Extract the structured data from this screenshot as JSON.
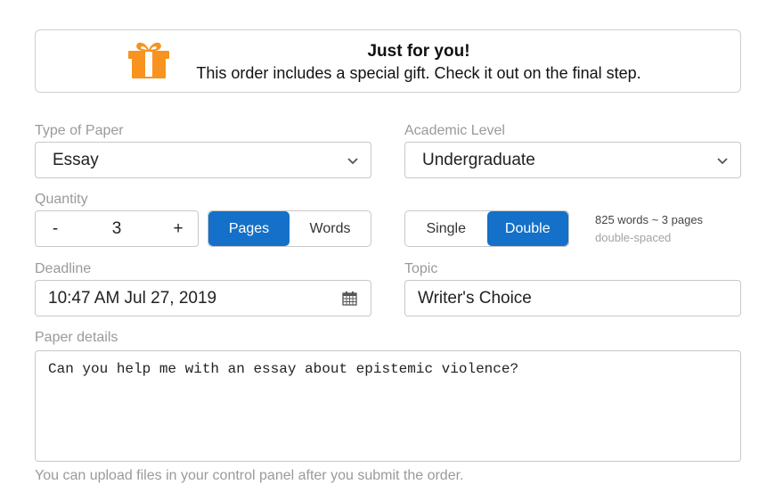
{
  "banner": {
    "icon": "gift-icon",
    "icon_color": "#f7931e",
    "title": "Just for you!",
    "subtitle": "This order includes a special gift. Check it out on the final step."
  },
  "form": {
    "type_of_paper": {
      "label": "Type of Paper",
      "value": "Essay"
    },
    "academic_level": {
      "label": "Academic Level",
      "value": "Undergraduate"
    },
    "quantity": {
      "label": "Quantity",
      "decrement": "-",
      "value": "3",
      "increment": "+",
      "units": [
        {
          "label": "Pages",
          "active": true
        },
        {
          "label": "Words",
          "active": false
        }
      ]
    },
    "spacing": {
      "options": [
        {
          "label": "Single",
          "active": false
        },
        {
          "label": "Double",
          "active": true
        }
      ],
      "summary": "825 words ~ 3 pages",
      "note": "double-spaced"
    },
    "deadline": {
      "label": "Deadline",
      "value": "10:47 AM Jul 27, 2019",
      "icon": "calendar-icon"
    },
    "topic": {
      "label": "Topic",
      "value": "Writer's Choice"
    },
    "paper_details": {
      "label": "Paper details",
      "value": "Can you help me with an essay about epistemic violence?"
    },
    "upload_note": "You can upload files in your control panel after you submit the order."
  },
  "colors": {
    "accent": "#1470c8",
    "gift": "#f7931e",
    "label": "#9a9a9a"
  }
}
